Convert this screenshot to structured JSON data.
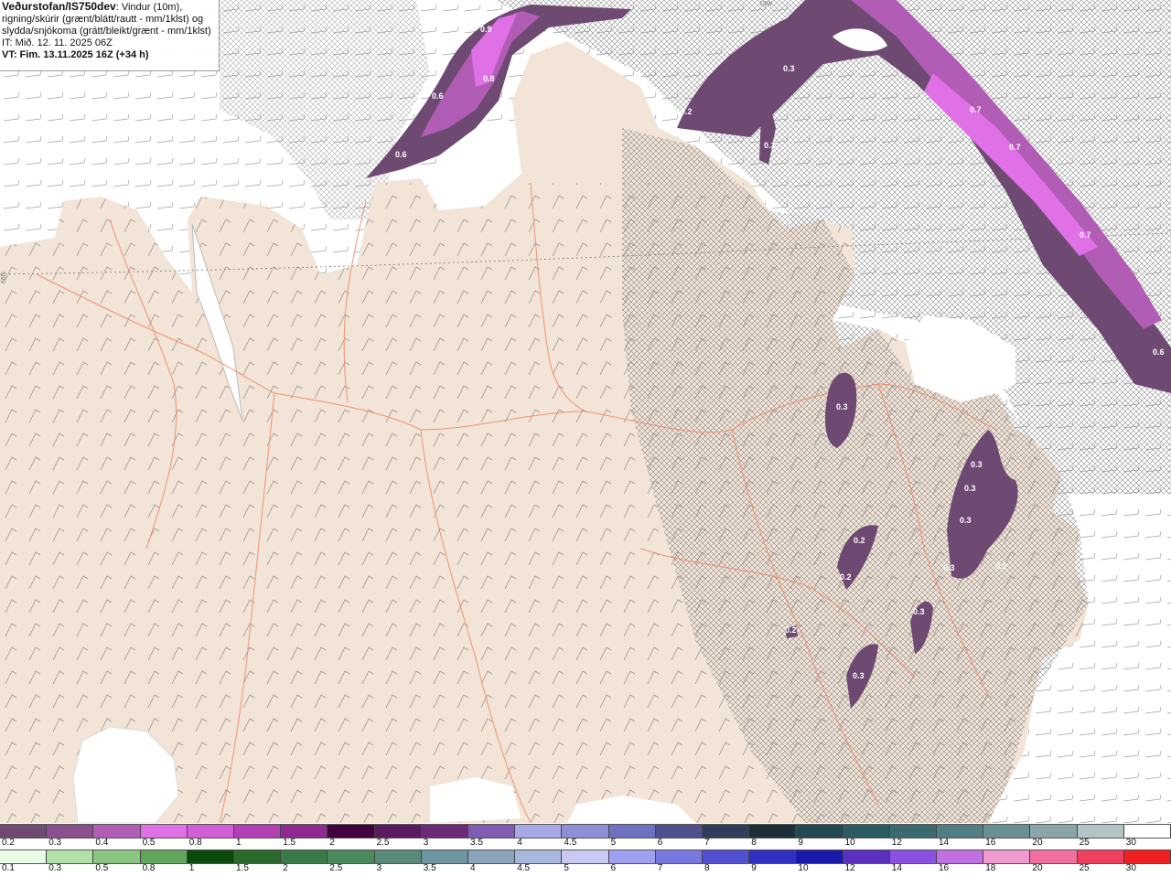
{
  "header": {
    "title": "Veðurstofan/IS750dev",
    "desc1": ": Vindur (10m),",
    "desc2": "rigning/skúrir (grænt/blátt/rautt - mm/1klst) og",
    "desc3": "slydda/snjókoma (grátt/bleikt/grænt - mm/1klst)",
    "it": "IT: Mið. 12. 11. 2025 06Z",
    "vt": "VT: Fim. 13.11.2025 16Z (+34 h)"
  },
  "grid_labels": {
    "lat": "66N",
    "lon": "15W"
  },
  "value_labels": [
    "0.9",
    "0.8",
    "0.6",
    "0.6",
    "0.3",
    "0.2",
    "0.7",
    "0.7",
    "0.7",
    "0.6",
    "0.3",
    "0.3",
    "0.3",
    "0.3",
    "0.3",
    "0.2",
    "0.2",
    "0.3",
    "0.2",
    "0.3",
    "0.2",
    "0.3"
  ],
  "snow_scale": {
    "labels": [
      "0.2",
      "0.3",
      "0.4",
      "0.5",
      "0.8",
      "1",
      "1.5",
      "2",
      "2.5",
      "3",
      "3.5",
      "4",
      "4.5",
      "5",
      "6",
      "7",
      "8",
      "9",
      "10",
      "12",
      "14",
      "16",
      "20",
      "25",
      "30"
    ],
    "colors": [
      "#6e4a73",
      "#8a4f8f",
      "#b25db5",
      "#e070e6",
      "#d35fd8",
      "#b43fb5",
      "#8f2b90",
      "#43003f",
      "#5a1a60",
      "#6a2a78",
      "#7f5cb3",
      "#a8a8e8",
      "#8f8fd8",
      "#7070c0",
      "#50508f",
      "#2e3f5c",
      "#1c3038",
      "#244850",
      "#2b5b62",
      "#3a6a70",
      "#517e84",
      "#6b9094",
      "#8aa5a8",
      "#b3c4c6",
      "#ffffff"
    ]
  },
  "rain_scale": {
    "labels": [
      "0.1",
      "0.3",
      "0.5",
      "0.8",
      "1",
      "1.5",
      "2",
      "2.5",
      "3",
      "3.5",
      "4",
      "4.5",
      "5",
      "6",
      "7",
      "8",
      "9",
      "10",
      "12",
      "14",
      "16",
      "18",
      "20",
      "25",
      "30"
    ],
    "colors": [
      "#e6ffe6",
      "#b0e0a8",
      "#8ac682",
      "#5fa55a",
      "#0c4a0c",
      "#2a6a2a",
      "#3a7a46",
      "#4a8a5c",
      "#5a8a7a",
      "#6e96a0",
      "#8aa4bc",
      "#a8b8dc",
      "#c8c8f0",
      "#a0a0f0",
      "#7878e0",
      "#5050d0",
      "#3030c0",
      "#1a1aaa",
      "#5a30c0",
      "#8a50e0",
      "#c070e0",
      "#f09ad0",
      "#f070a0",
      "#f04060",
      "#f02020"
    ]
  }
}
